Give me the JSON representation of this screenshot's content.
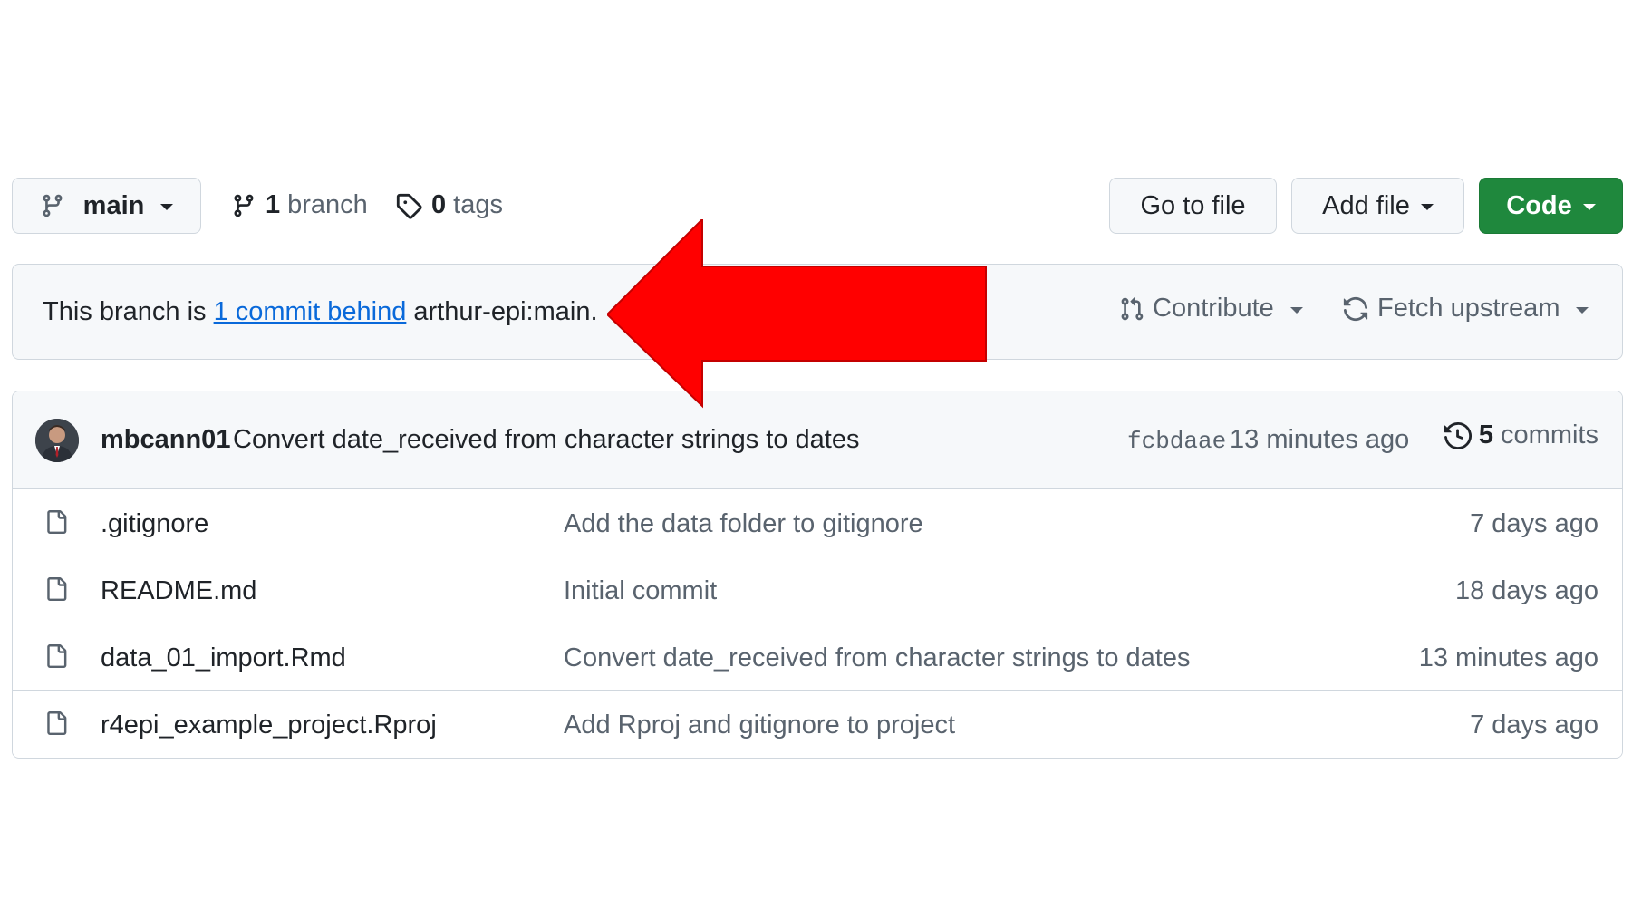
{
  "toolbar": {
    "branch_button": {
      "label": "main",
      "icon": "git-branch-icon"
    },
    "branches": {
      "count": "1",
      "label": "branch",
      "icon": "git-branch-icon"
    },
    "tags": {
      "count": "0",
      "label": "tags",
      "icon": "tag-icon"
    },
    "go_to_file": "Go to file",
    "add_file": "Add file",
    "code": "Code"
  },
  "banner": {
    "prefix": "This branch is",
    "link": "1 commit behind",
    "suffix": "arthur-epi:main.",
    "contribute": "Contribute",
    "fetch_upstream": "Fetch upstream"
  },
  "latest_commit": {
    "author": "mbcann01",
    "message": "Convert date_received from character strings to dates",
    "sha": "fcbdaae",
    "time": "13 minutes ago",
    "commits_count": "5",
    "commits_label": "commits"
  },
  "files": [
    {
      "name": ".gitignore",
      "message": "Add the data folder to gitignore",
      "time": "7 days ago"
    },
    {
      "name": "README.md",
      "message": "Initial commit",
      "time": "18 days ago"
    },
    {
      "name": "data_01_import.Rmd",
      "message": "Convert date_received from character strings to dates",
      "time": "13 minutes ago"
    },
    {
      "name": "r4epi_example_project.Rproj",
      "message": "Add Rproj and gitignore to project",
      "time": "7 days ago"
    }
  ],
  "colors": {
    "primary_button": "#1f883d",
    "link": "#0969da",
    "annotation_arrow": "#ff0000",
    "muted_text": "#59636e",
    "border": "#d0d7de"
  }
}
